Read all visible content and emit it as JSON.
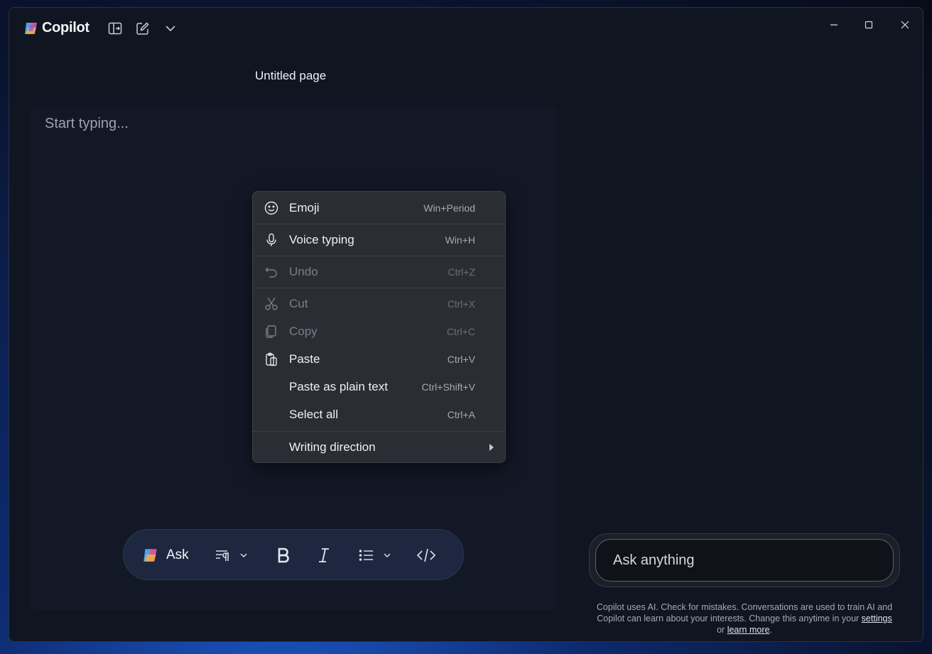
{
  "app": {
    "title": "Copilot"
  },
  "page": {
    "title": "Untitled page"
  },
  "editor": {
    "placeholder": "Start typing..."
  },
  "context_menu": {
    "items": [
      {
        "label": "Emoji",
        "shortcut": "Win+Period",
        "icon": "emoji-icon",
        "enabled": true
      },
      {
        "label": "Voice typing",
        "shortcut": "Win+H",
        "icon": "microphone-icon",
        "enabled": true
      },
      {
        "label": "Undo",
        "shortcut": "Ctrl+Z",
        "icon": "undo-icon",
        "enabled": false
      },
      {
        "label": "Cut",
        "shortcut": "Ctrl+X",
        "icon": "scissors-icon",
        "enabled": false
      },
      {
        "label": "Copy",
        "shortcut": "Ctrl+C",
        "icon": "copy-icon",
        "enabled": false
      },
      {
        "label": "Paste",
        "shortcut": "Ctrl+V",
        "icon": "paste-icon",
        "enabled": true
      },
      {
        "label": "Paste as plain text",
        "shortcut": "Ctrl+Shift+V",
        "icon": "",
        "enabled": true
      },
      {
        "label": "Select all",
        "shortcut": "Ctrl+A",
        "icon": "",
        "enabled": true
      },
      {
        "label": "Writing direction",
        "shortcut": "",
        "icon": "chevron-right-icon",
        "enabled": true
      }
    ]
  },
  "toolbar": {
    "ask_label": "Ask",
    "tools": [
      "paragraph-style-icon",
      "bold-icon",
      "italic-icon",
      "list-icon",
      "code-icon"
    ]
  },
  "chat": {
    "placeholder": "Ask anything"
  },
  "disclaimer": {
    "text": "Copilot uses AI. Check for mistakes. Conversations are used to train AI and Copilot can learn about your interests. Change this anytime in your",
    "link_settings": "settings",
    "or": "or",
    "link_learn_more": "learn more",
    "end": "."
  },
  "colors": {
    "accent": "#1d2740",
    "background": "#101522",
    "menu": "#2a2d33"
  }
}
